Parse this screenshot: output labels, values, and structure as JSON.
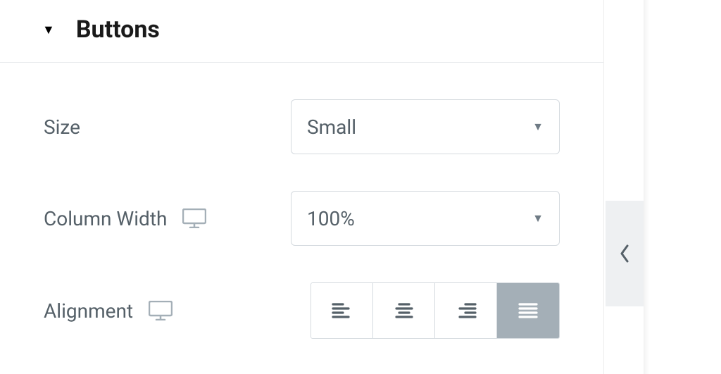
{
  "section": {
    "title": "Buttons"
  },
  "fields": {
    "size": {
      "label": "Size",
      "value": "Small"
    },
    "column_width": {
      "label": "Column Width",
      "value": "100%"
    },
    "alignment": {
      "label": "Alignment",
      "selected": "justify"
    }
  }
}
